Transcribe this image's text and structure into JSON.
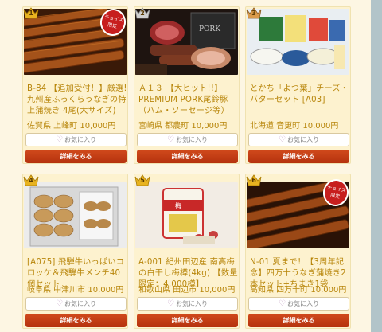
{
  "products": [
    {
      "rank": "1",
      "title": "B-84 【追加受付！】厳選! 九州産ふっくらうなぎの特上蒲焼き 4尾(大サイズ)",
      "location": "佐賀県 上峰町 10,000円",
      "choice_badge": "チョイス限定",
      "fav_label": "お気に入り",
      "detail_label": "詳細をみる",
      "photo": "eel"
    },
    {
      "rank": "2",
      "title": "Ａ１３ 【大ヒット!!】PREMIUM PORK尾鈴豚（ハム・ソーセージ等）",
      "location": "宮崎県 都農町 10,000円",
      "fav_label": "お気に入り",
      "detail_label": "詳細をみる",
      "photo": "ham"
    },
    {
      "rank": "3",
      "title": "とかち「よつ葉」チーズ・バターセット [A03]",
      "location": "北海道 音更町 10,000円",
      "fav_label": "お気に入り",
      "detail_label": "詳細をみる",
      "photo": "cheese"
    },
    {
      "rank": "4",
      "title": "[A075] 飛騨牛いっぱいコロッケ＆飛騨牛メンチ40個セット",
      "location": "岐阜県 中津川市 10,000円",
      "fav_label": "お気に入り",
      "detail_label": "詳細をみる",
      "photo": "croquette"
    },
    {
      "rank": "5",
      "title": "A-001 紀州田辺産 南高梅の白干し梅樽(4kg) 【数量限定：4,000樽】",
      "location": "和歌山県 田辺市 10,000円",
      "fav_label": "お気に入り",
      "detail_label": "詳細をみる",
      "photo": "ume"
    },
    {
      "rank": "6",
      "title": "N-01 夏まで！【3周年記念】四万十うなぎ蒲焼き2本セット+ちまき1袋",
      "location": "高知県 四万十町 10,000円",
      "choice_badge": "チョイス限定",
      "fav_label": "お気に入り",
      "detail_label": "詳細をみる",
      "photo": "eel2"
    }
  ],
  "colors": {
    "accent_text": "#b8860b",
    "detail_button": "#c23d14",
    "card_bg": "#fdf2cf",
    "page_bg": "#fdf6e3"
  }
}
